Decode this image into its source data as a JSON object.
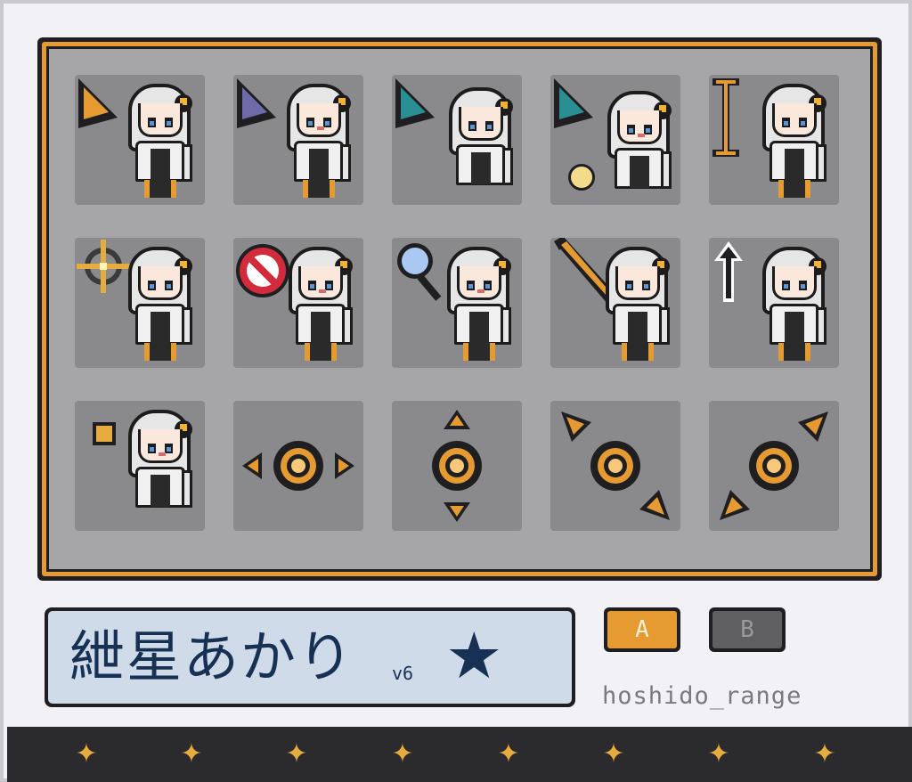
{
  "name_panel": {
    "title": "紲星あかり",
    "version": "v6",
    "emblem": "★"
  },
  "buttons": {
    "a_label": "A",
    "b_label": "B"
  },
  "credit": "hoshido_range",
  "cursors": [
    {
      "kind": "normal-select",
      "icon": "arrow-orange-icon"
    },
    {
      "kind": "help-select",
      "icon": "arrow-purple-icon"
    },
    {
      "kind": "working-in-background",
      "icon": "arrow-teal-icon"
    },
    {
      "kind": "busy",
      "icon": "arrow-teal-loading-icon"
    },
    {
      "kind": "text-select",
      "icon": "i-beam-icon"
    },
    {
      "kind": "precision-select",
      "icon": "crosshair-icon"
    },
    {
      "kind": "unavailable",
      "icon": "no-sign-icon"
    },
    {
      "kind": "location-select",
      "icon": "magnifier-icon"
    },
    {
      "kind": "handwriting",
      "icon": "pencil-icon"
    },
    {
      "kind": "alternate-select",
      "icon": "up-arrow-icon"
    },
    {
      "kind": "link-select",
      "icon": "dot-icon"
    },
    {
      "kind": "horizontal-resize",
      "icon": "horizontal-resize-icon"
    },
    {
      "kind": "vertical-resize",
      "icon": "vertical-resize-icon"
    },
    {
      "kind": "diagonal-resize-1",
      "icon": "diagonal-resize-nw-se-icon"
    },
    {
      "kind": "diagonal-resize-2",
      "icon": "diagonal-resize-ne-sw-icon"
    }
  ],
  "colors": {
    "accent": "#e69a32",
    "navy": "#173154",
    "panel": "#a6a6a9",
    "cell": "#8a8a8d"
  }
}
